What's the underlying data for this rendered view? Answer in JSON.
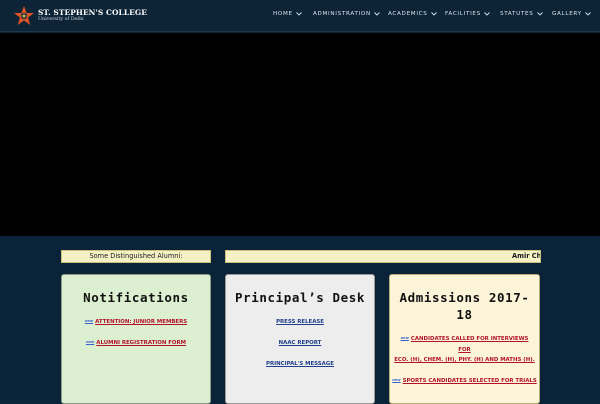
{
  "header": {
    "college_name": "ST. STEPHEN'S COLLEGE",
    "university": "University of Delhi",
    "brand_color": "#0d2437",
    "accent_color": "#e0542a"
  },
  "nav": {
    "items": [
      {
        "label": "HOME"
      },
      {
        "label": "ADMINISTRATION"
      },
      {
        "label": "ACADEMICS"
      },
      {
        "label": "FACILITIES"
      },
      {
        "label": "STATUTES"
      },
      {
        "label": "GALLERY"
      }
    ]
  },
  "ticker": {
    "label": "Some Distinguished Alumni:",
    "text": "Amir Ch"
  },
  "cards": {
    "notifications": {
      "title": "Notifications",
      "badge": "new",
      "links": [
        "ATTENTION: JUNIOR MEMBERS",
        "ALUMNI REGISTRATION FORM"
      ]
    },
    "principal": {
      "title": "Principal’s Desk",
      "links": [
        "PRESS RELEASE",
        "NAAC REPORT",
        "PRINCIPAL'S MESSAGE"
      ]
    },
    "admissions": {
      "title_line1": "Admissions 2017-",
      "title_line2": "18",
      "badge": "new",
      "links": [
        "CANDIDATES CALLED FOR INTERVIEWS",
        "FOR",
        "ECO. (H), CHEM. (H), PHY. (H) AND MATHS (H).",
        "SPORTS CANDIDATES SELECTED FOR TRIALS"
      ]
    }
  }
}
